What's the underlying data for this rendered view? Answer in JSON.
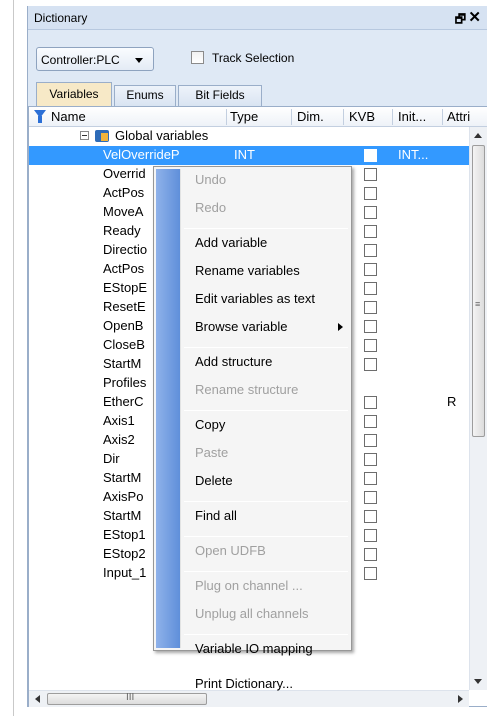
{
  "window": {
    "title": "Dictionary",
    "pin_glyph": "🗗",
    "close_glyph": "✕"
  },
  "toolbar": {
    "controller": "Controller:PLC",
    "track_selection": "Track Selection"
  },
  "tabs": [
    {
      "label": "Variables",
      "active": true
    },
    {
      "label": "Enums",
      "active": false
    },
    {
      "label": "Bit Fields",
      "active": false
    }
  ],
  "columns": [
    "Name",
    "Type",
    "Dim.",
    "KVB",
    "Init...",
    "Attri"
  ],
  "group": {
    "label": "Global variables"
  },
  "rows": [
    {
      "name": "VelOverrideP",
      "type": "INT",
      "init": "INT...",
      "attr": "",
      "kvb": true,
      "selected": true
    },
    {
      "name": "Overrid",
      "kvb": true
    },
    {
      "name": "ActPos",
      "kvb": true
    },
    {
      "name": "MoveA",
      "kvb": true
    },
    {
      "name": "Ready",
      "kvb": true
    },
    {
      "name": "Directio",
      "kvb": true
    },
    {
      "name": "ActPos",
      "kvb": true
    },
    {
      "name": "EStopE",
      "kvb": true
    },
    {
      "name": "ResetE",
      "kvb": true
    },
    {
      "name": "OpenB",
      "kvb": true
    },
    {
      "name": "CloseB",
      "kvb": true
    },
    {
      "name": "StartM",
      "kvb": true
    },
    {
      "name": "Profiles",
      "kvb": false
    },
    {
      "name": "EtherC",
      "kvb": true,
      "attr": "R"
    },
    {
      "name": "Axis1",
      "kvb": true
    },
    {
      "name": "Axis2",
      "kvb": true
    },
    {
      "name": "Dir",
      "kvb": true
    },
    {
      "name": "StartM",
      "kvb": true
    },
    {
      "name": "AxisPo",
      "kvb": true
    },
    {
      "name": "StartM",
      "kvb": true
    },
    {
      "name": "EStop1",
      "kvb": true
    },
    {
      "name": "EStop2",
      "kvb": true
    },
    {
      "name": "Input_1",
      "kvb": true
    }
  ],
  "context_menu": {
    "items": [
      {
        "label": "Undo",
        "enabled": false
      },
      {
        "label": "Redo",
        "enabled": false
      },
      {
        "sep": true
      },
      {
        "label": "Add variable",
        "enabled": true
      },
      {
        "label": "Rename variables",
        "enabled": true
      },
      {
        "label": "Edit variables as text",
        "enabled": true
      },
      {
        "label": "Browse variable",
        "enabled": true,
        "submenu": true
      },
      {
        "sep": true
      },
      {
        "label": "Add structure",
        "enabled": true
      },
      {
        "label": "Rename structure",
        "enabled": false
      },
      {
        "sep": true
      },
      {
        "label": "Copy",
        "enabled": true
      },
      {
        "label": "Paste",
        "enabled": false
      },
      {
        "label": "Delete",
        "enabled": true
      },
      {
        "sep": true
      },
      {
        "label": "Find all",
        "enabled": true
      },
      {
        "sep": true
      },
      {
        "label": "Open UDFB",
        "enabled": false
      },
      {
        "sep": true
      },
      {
        "label": "Plug on channel ...",
        "enabled": false
      },
      {
        "label": "Unplug all channels",
        "enabled": false
      },
      {
        "sep": true
      },
      {
        "label": "Variable IO mapping",
        "enabled": true
      },
      {
        "sep": true
      },
      {
        "label": "Print Dictionary...",
        "enabled": true
      }
    ]
  },
  "scrollbar": {
    "v_grip": "≡",
    "h_grip": "III"
  }
}
